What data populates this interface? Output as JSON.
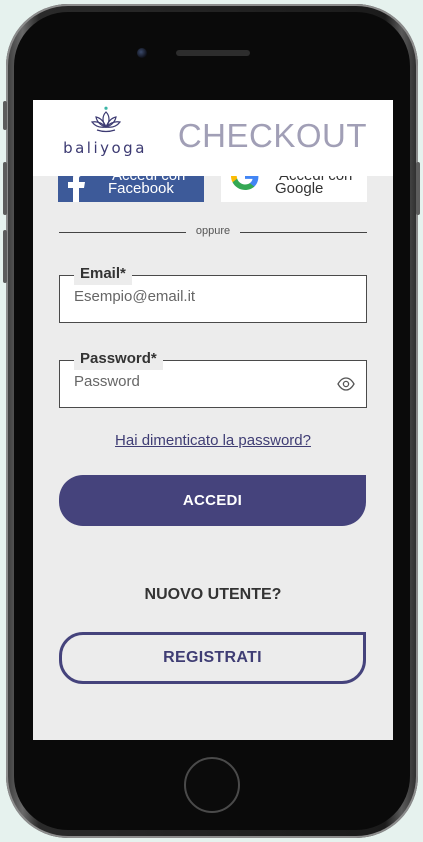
{
  "header": {
    "logo_text": "baliyoga",
    "title": "CHECKOUT"
  },
  "social": {
    "facebook_line1": "Accedi con",
    "facebook_line2": "Facebook",
    "google_line1": "Accedi con",
    "google_line2": "Google"
  },
  "divider_text": "oppure",
  "form": {
    "email_label": "Email*",
    "email_placeholder": "Esempio@email.it",
    "password_label": "Password*",
    "password_placeholder": "Password",
    "forgot_link": "Hai dimenticato la password?",
    "login_button": "ACCEDI"
  },
  "register": {
    "prompt": "NUOVO UTENTE?",
    "button": "REGISTRATI"
  },
  "icons": {
    "logo": "lotus-icon",
    "facebook": "facebook-icon",
    "google": "google-icon",
    "password_toggle": "eye-icon"
  },
  "colors": {
    "brand": "#45437c",
    "facebook": "#3d5a99",
    "title": "#a19fb6"
  }
}
